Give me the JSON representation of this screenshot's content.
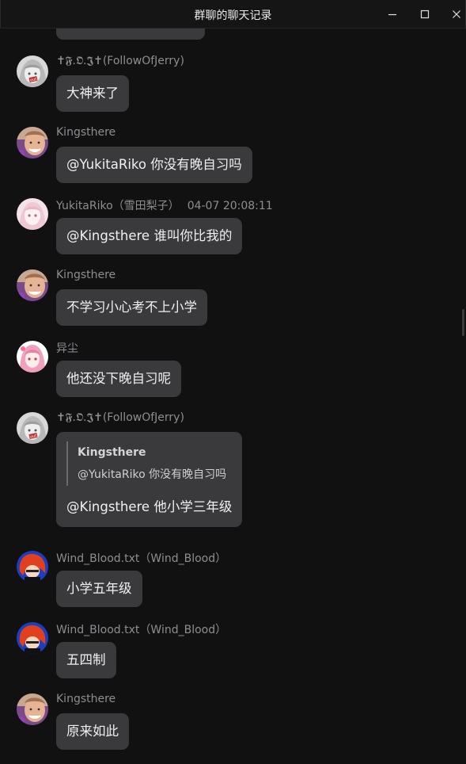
{
  "window": {
    "title": "群聊的聊天记录",
    "minimize_icon": "minimize-icon",
    "maximize_icon": "maximize-icon",
    "close_icon": "close-icon"
  },
  "messages": [
    {
      "sender": "✝𝕱.𝕺.𝕵✝(FollowOfJerry)",
      "time": "",
      "text": "大神来了",
      "avatar": "gray-anime-girl-avatar"
    },
    {
      "sender": "Kingsthere",
      "time": "",
      "text": "@YukitaRiko 你没有晚自习吗",
      "avatar": "smiling-man-avatar"
    },
    {
      "sender": "YukitaRiko（雪田梨子）",
      "time": "04-07 20:08:11",
      "text": "@Kingsthere 谁叫你比我的",
      "avatar": "pink-anime-girl-avatar"
    },
    {
      "sender": "Kingsthere",
      "time": "",
      "text": "不学习小心考不上小学",
      "avatar": "smiling-man-avatar"
    },
    {
      "sender": "异尘",
      "time": "",
      "text": "他还没下晚自习呢",
      "avatar": "pink-hair-girl-avatar"
    },
    {
      "sender": "✝𝕱.𝕺.𝕵✝(FollowOfJerry)",
      "time": "",
      "text": "@Kingsthere 他小学三年级",
      "avatar": "gray-anime-girl-avatar",
      "quote": {
        "name": "Kingsthere",
        "text": "@YukitaRiko 你没有晚自习吗"
      }
    },
    {
      "sender": "Wind_Blood.txt（Wind_Blood）",
      "time": "",
      "text": "小学五年级",
      "avatar": "red-hair-character-avatar"
    },
    {
      "sender": "Wind_Blood.txt（Wind_Blood）",
      "time": "",
      "text": "五四制",
      "avatar": "red-hair-character-avatar"
    },
    {
      "sender": "Kingsthere",
      "time": "",
      "text": "原来如此",
      "avatar": "smiling-man-avatar"
    }
  ]
}
